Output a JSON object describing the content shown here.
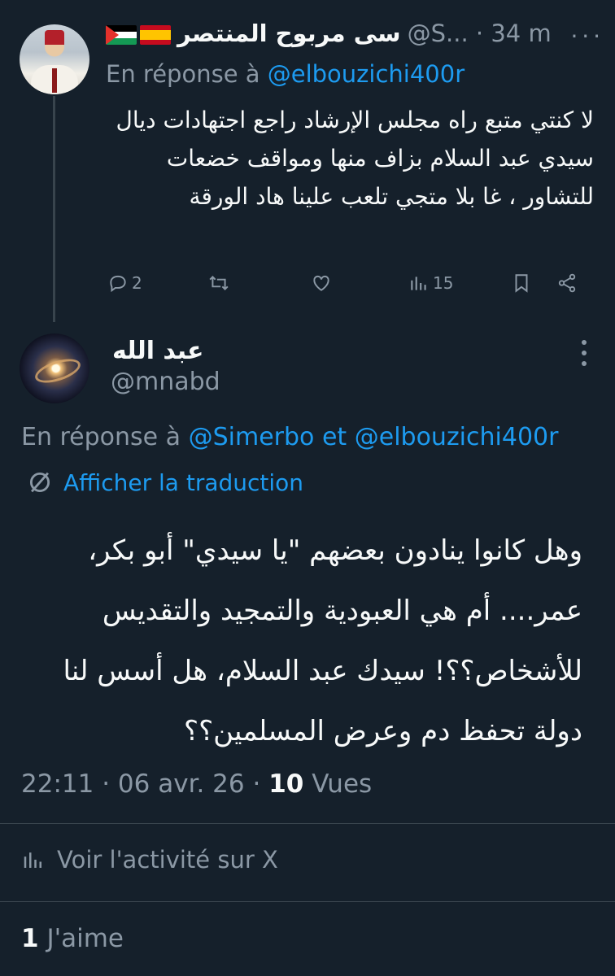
{
  "parent_tweet": {
    "display_name": "سى مربوح المنتصر",
    "handle": "@S...",
    "time": "34 m",
    "reply_prefix": "En réponse à",
    "reply_to": "@elbouzichi400r",
    "text": "لا كنتي متبع راه مجلس الإرشاد راجع اجتهادات ديال سيدي عبد السلام بزاف منها ومواقف خضعات للتشاور ، غا بلا متجي تلعب علينا هاد الورقة",
    "replies": "2",
    "reposts": "",
    "likes": "",
    "views": "15",
    "icons": [
      "reply-icon",
      "repost-icon",
      "like-icon",
      "views-icon",
      "bookmark-icon",
      "share-icon"
    ]
  },
  "main_tweet": {
    "display_name": "عبد الله",
    "handle": "@mnabd",
    "reply_prefix": "En réponse à",
    "reply_to_1": "@Simerbo",
    "reply_joiner": "et",
    "reply_to_2": "@elbouzichi400r",
    "translate_label": "Afficher la traduction",
    "text": "وهل كانوا ينادون بعضهم \"يا سيدي\"  أبو بكر، عمر.... أم هي العبودية والتمجيد والتقديس للأشخاص؟؟! سيدك عبد السلام، هل أسس لنا دولة تحفظ دم وعرض المسلمين؟؟",
    "time": "22:11",
    "date": "06 avr. 26",
    "views_count": "10",
    "views_label": "Vues",
    "activity_label": "Voir l'activité sur X",
    "likes_count": "1",
    "likes_label": "J'aime"
  },
  "colors": {
    "background": "#15202b",
    "text": "#f7f9f9",
    "muted": "#8b98a5",
    "accent": "#1d9bf0",
    "divider": "#38444d"
  }
}
